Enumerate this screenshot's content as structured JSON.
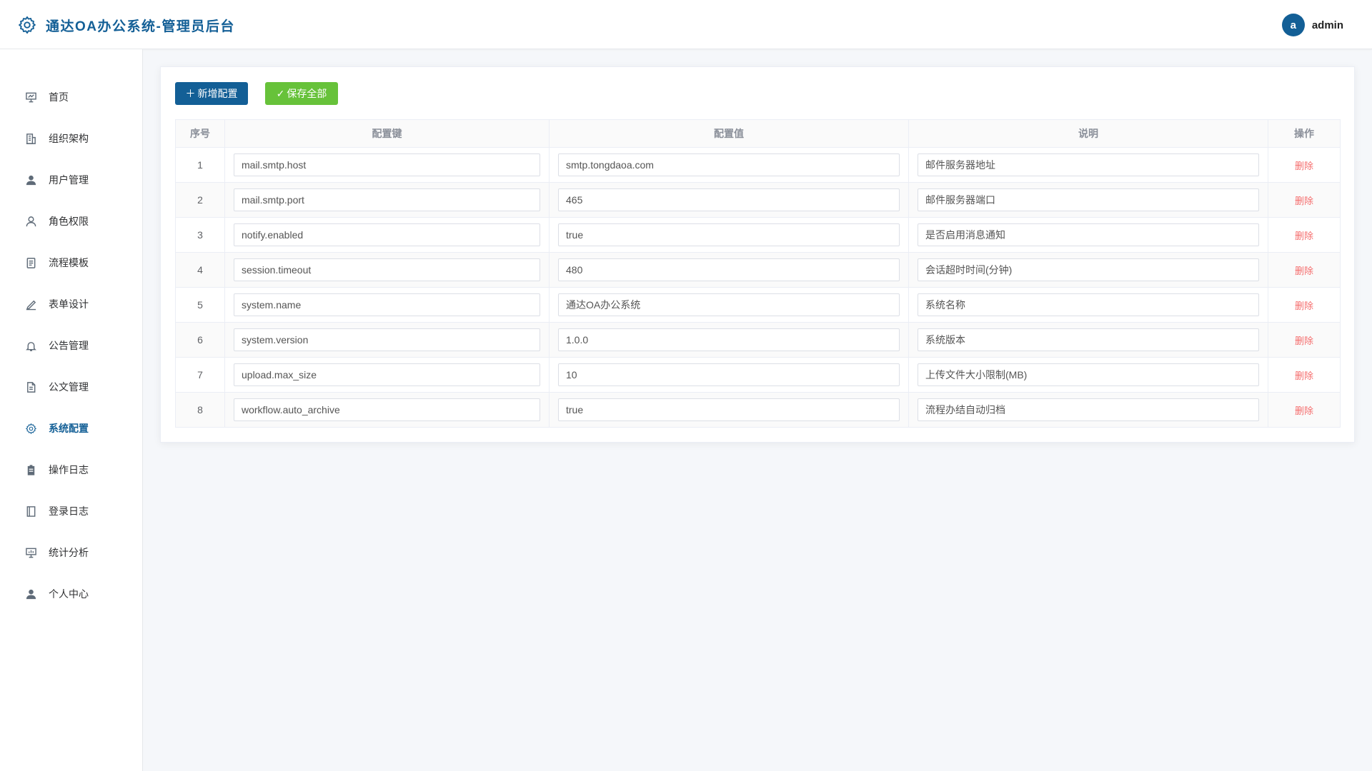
{
  "app": {
    "title": "通达OA办公系统-管理员后台"
  },
  "user": {
    "avatar_letter": "a",
    "name": "admin"
  },
  "colors": {
    "brand": "#135f96",
    "success": "#67c23a",
    "danger": "#f56c6c"
  },
  "sidebar": {
    "items": [
      {
        "label": "首页",
        "icon": "dashboard-icon"
      },
      {
        "label": "组织架构",
        "icon": "building-icon"
      },
      {
        "label": "用户管理",
        "icon": "user-filled-icon"
      },
      {
        "label": "角色权限",
        "icon": "user-outline-icon"
      },
      {
        "label": "流程模板",
        "icon": "document-icon"
      },
      {
        "label": "表单设计",
        "icon": "edit-pen-icon"
      },
      {
        "label": "公告管理",
        "icon": "bell-icon"
      },
      {
        "label": "公文管理",
        "icon": "file-text-icon"
      },
      {
        "label": "系统配置",
        "icon": "settings-gear-icon",
        "active": true
      },
      {
        "label": "操作日志",
        "icon": "clipboard-icon"
      },
      {
        "label": "登录日志",
        "icon": "notebook-icon"
      },
      {
        "label": "统计分析",
        "icon": "chart-board-icon"
      },
      {
        "label": "个人中心",
        "icon": "user-filled-icon"
      }
    ]
  },
  "toolbar": {
    "add_label": "新增配置",
    "add_icon": "plus-icon",
    "save_label": "保存全部",
    "save_icon": "check-icon"
  },
  "table": {
    "headers": {
      "index": "序号",
      "key": "配置键",
      "value": "配置值",
      "desc": "说明",
      "action": "操作"
    },
    "delete_label": "删除",
    "rows": [
      {
        "index": "1",
        "key": "mail.smtp.host",
        "value": "smtp.tongdaoa.com",
        "desc": "邮件服务器地址"
      },
      {
        "index": "2",
        "key": "mail.smtp.port",
        "value": "465",
        "desc": "邮件服务器端口"
      },
      {
        "index": "3",
        "key": "notify.enabled",
        "value": "true",
        "desc": "是否启用消息通知"
      },
      {
        "index": "4",
        "key": "session.timeout",
        "value": "480",
        "desc": "会话超时时间(分钟)"
      },
      {
        "index": "5",
        "key": "system.name",
        "value": "通达OA办公系统",
        "desc": "系统名称"
      },
      {
        "index": "6",
        "key": "system.version",
        "value": "1.0.0",
        "desc": "系统版本"
      },
      {
        "index": "7",
        "key": "upload.max_size",
        "value": "10",
        "desc": "上传文件大小限制(MB)"
      },
      {
        "index": "8",
        "key": "workflow.auto_archive",
        "value": "true",
        "desc": "流程办结自动归档"
      }
    ]
  }
}
